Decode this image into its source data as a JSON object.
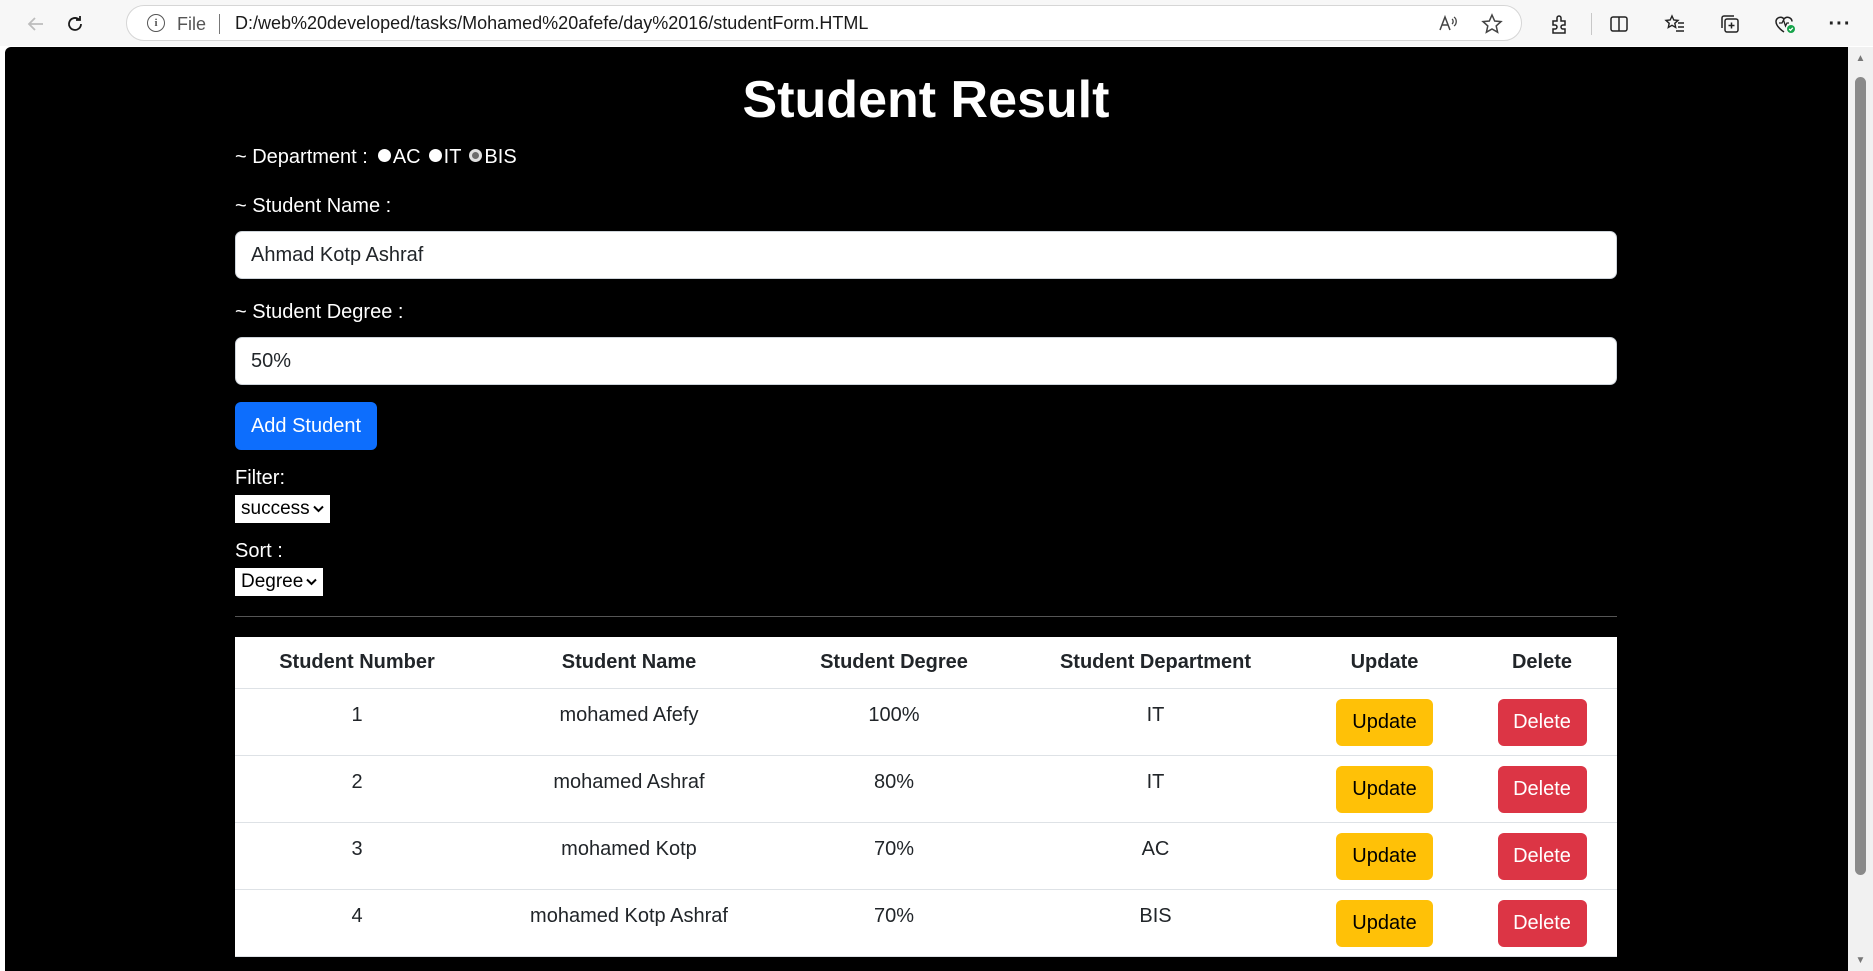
{
  "browser": {
    "file_label": "File",
    "url": "D:/web%20developed/tasks/Mohamed%20afefe/day%2016/studentForm.HTML"
  },
  "page": {
    "title": "Student Result",
    "department_label": "~ Department :",
    "department_options": [
      "AC",
      "IT",
      "BIS"
    ],
    "department_selected": "BIS",
    "name_label": "~ Student Name :",
    "name_value": "Ahmad Kotp Ashraf",
    "degree_label": "~ Student Degree :",
    "degree_value": "50%",
    "add_button": "Add Student",
    "filter_label": "Filter:",
    "filter_value": "success",
    "sort_label": "Sort :",
    "sort_value": "Degree"
  },
  "table": {
    "headers": [
      "Student Number",
      "Student Name",
      "Student Degree",
      "Student Department",
      "Update",
      "Delete"
    ],
    "rows": [
      {
        "number": "1",
        "name": "mohamed Afefy",
        "degree": "100%",
        "department": "IT",
        "update": "Update",
        "delete": "Delete"
      },
      {
        "number": "2",
        "name": "mohamed Ashraf",
        "degree": "80%",
        "department": "IT",
        "update": "Update",
        "delete": "Delete"
      },
      {
        "number": "3",
        "name": "mohamed Kotp",
        "degree": "70%",
        "department": "AC",
        "update": "Update",
        "delete": "Delete"
      },
      {
        "number": "4",
        "name": "mohamed Kotp Ashraf",
        "degree": "70%",
        "department": "BIS",
        "update": "Update",
        "delete": "Delete"
      }
    ]
  },
  "colors": {
    "page_background": "#000000",
    "primary": "#0d6efd",
    "warning": "#ffc107",
    "danger": "#dc3545"
  },
  "icons": {
    "back": "back-arrow-icon",
    "refresh": "refresh-icon",
    "info": "info-icon",
    "read_aloud": "read-aloud-icon",
    "favorite": "star-icon",
    "extensions": "extensions-icon",
    "split": "split-screen-icon",
    "favorites": "favorites-icon",
    "collections": "collections-icon",
    "health": "browser-essentials-icon",
    "more": "more-icon"
  }
}
